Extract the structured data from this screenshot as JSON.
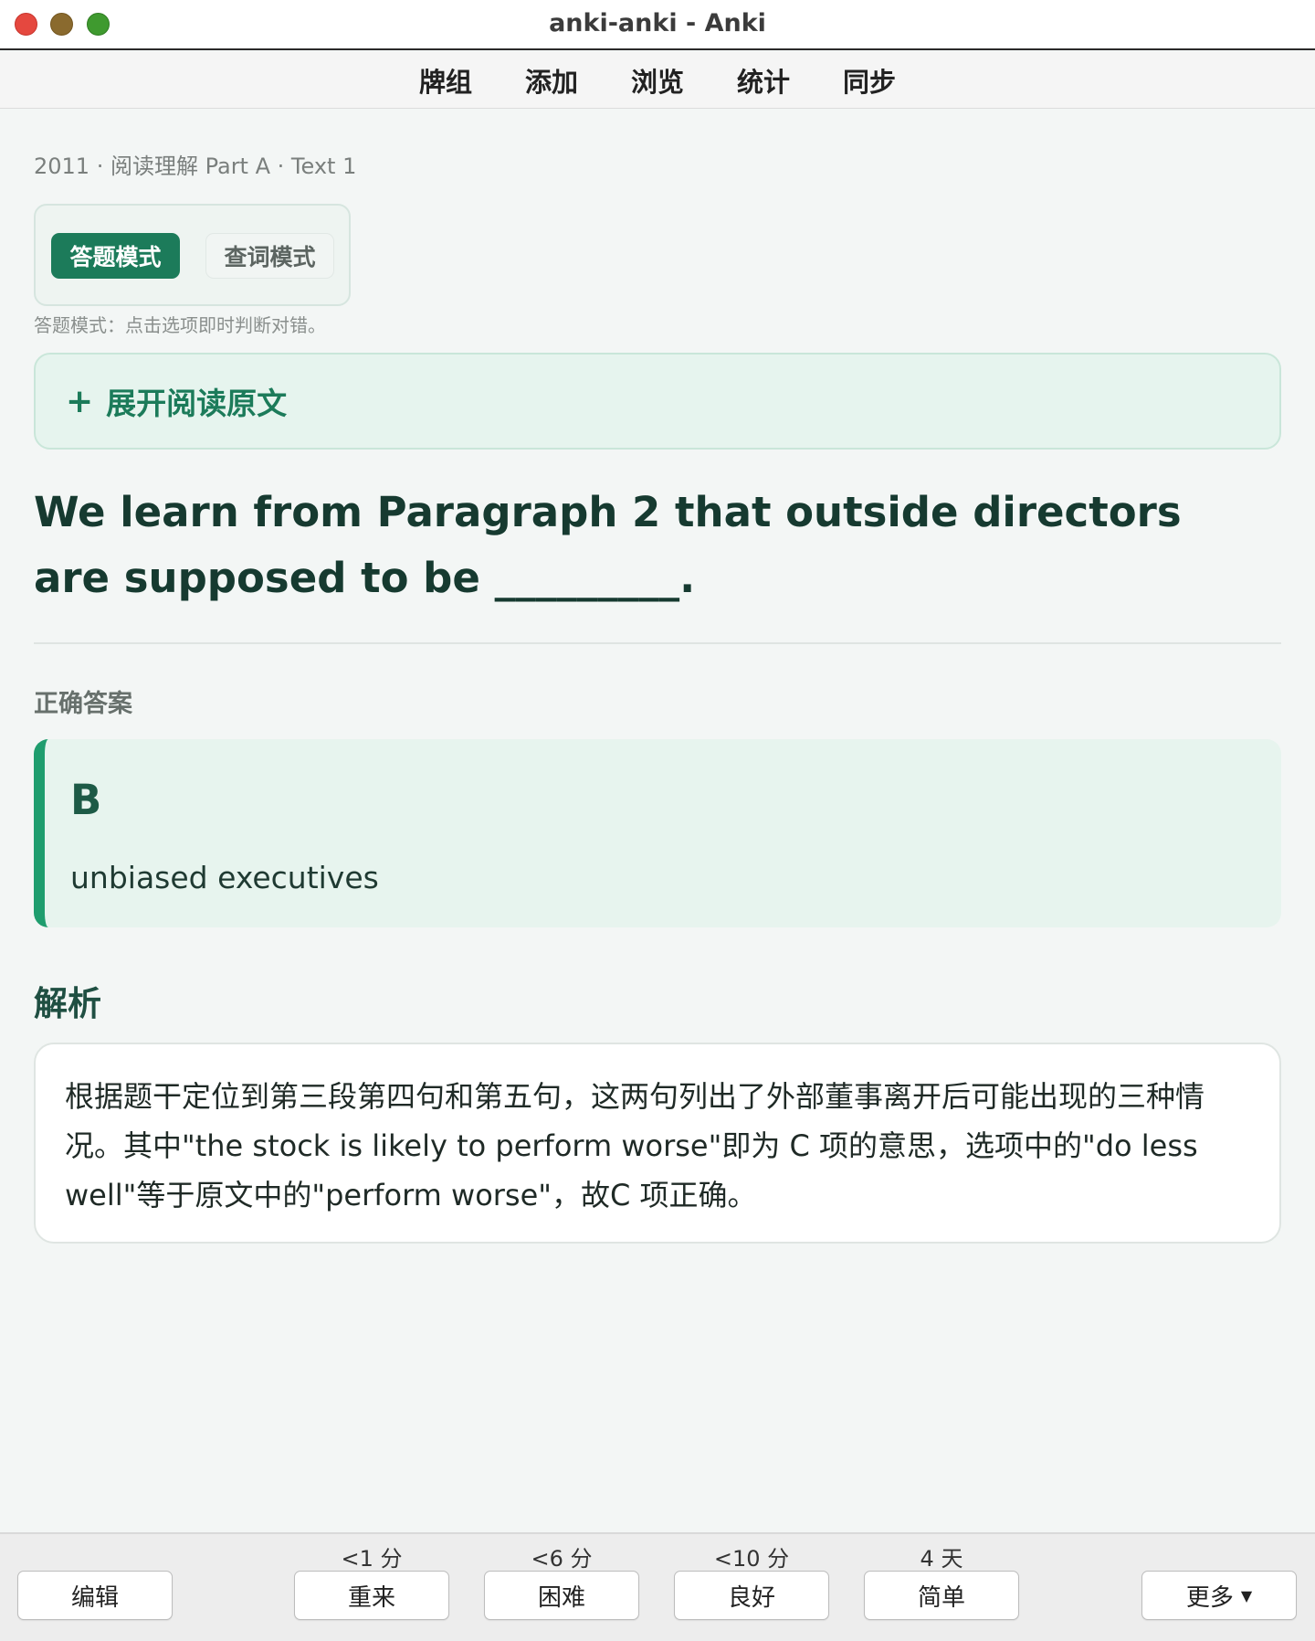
{
  "window": {
    "title": "anki-anki - Anki"
  },
  "menu": {
    "items": [
      "牌组",
      "添加",
      "浏览",
      "统计",
      "同步"
    ]
  },
  "card": {
    "breadcrumb": "2011 · 阅读理解 Part A · Text 1",
    "modes": {
      "answer_mode": "答题模式",
      "lookup_mode": "查词模式",
      "active": "答题模式"
    },
    "mode_hint": "答题模式：点击选项即时判断对错。",
    "expand": {
      "icon": "plus-icon",
      "label": "展开阅读原文"
    },
    "question": "We learn from Paragraph 2 that outside directors are supposed to be _________.",
    "answer_heading": "正确答案",
    "answer_letter": "B",
    "answer_text": "unbiased executives",
    "analysis_heading": "解析",
    "analysis_text": "根据题干定位到第三段第四句和第五句，这两句列出了外部董事离开后可能出现的三种情况。其中\"the stock is likely to perform worse\"即为 C 项的意思，选项中的\"do less well\"等于原文中的\"perform worse\"，故C 项正确。"
  },
  "bottom": {
    "edit_label": "编辑",
    "more_label": "更多",
    "more_icon": "caret-down-icon",
    "ease": [
      {
        "time": "<1 分",
        "label": "重来"
      },
      {
        "time": "<6 分",
        "label": "困难"
      },
      {
        "time": "<10 分",
        "label": "良好"
      },
      {
        "time": "4 天",
        "label": "简单"
      }
    ]
  },
  "colors": {
    "accent": "#1c7b5a",
    "answer_border": "#1f9d6e",
    "background": "#f3f6f5"
  }
}
